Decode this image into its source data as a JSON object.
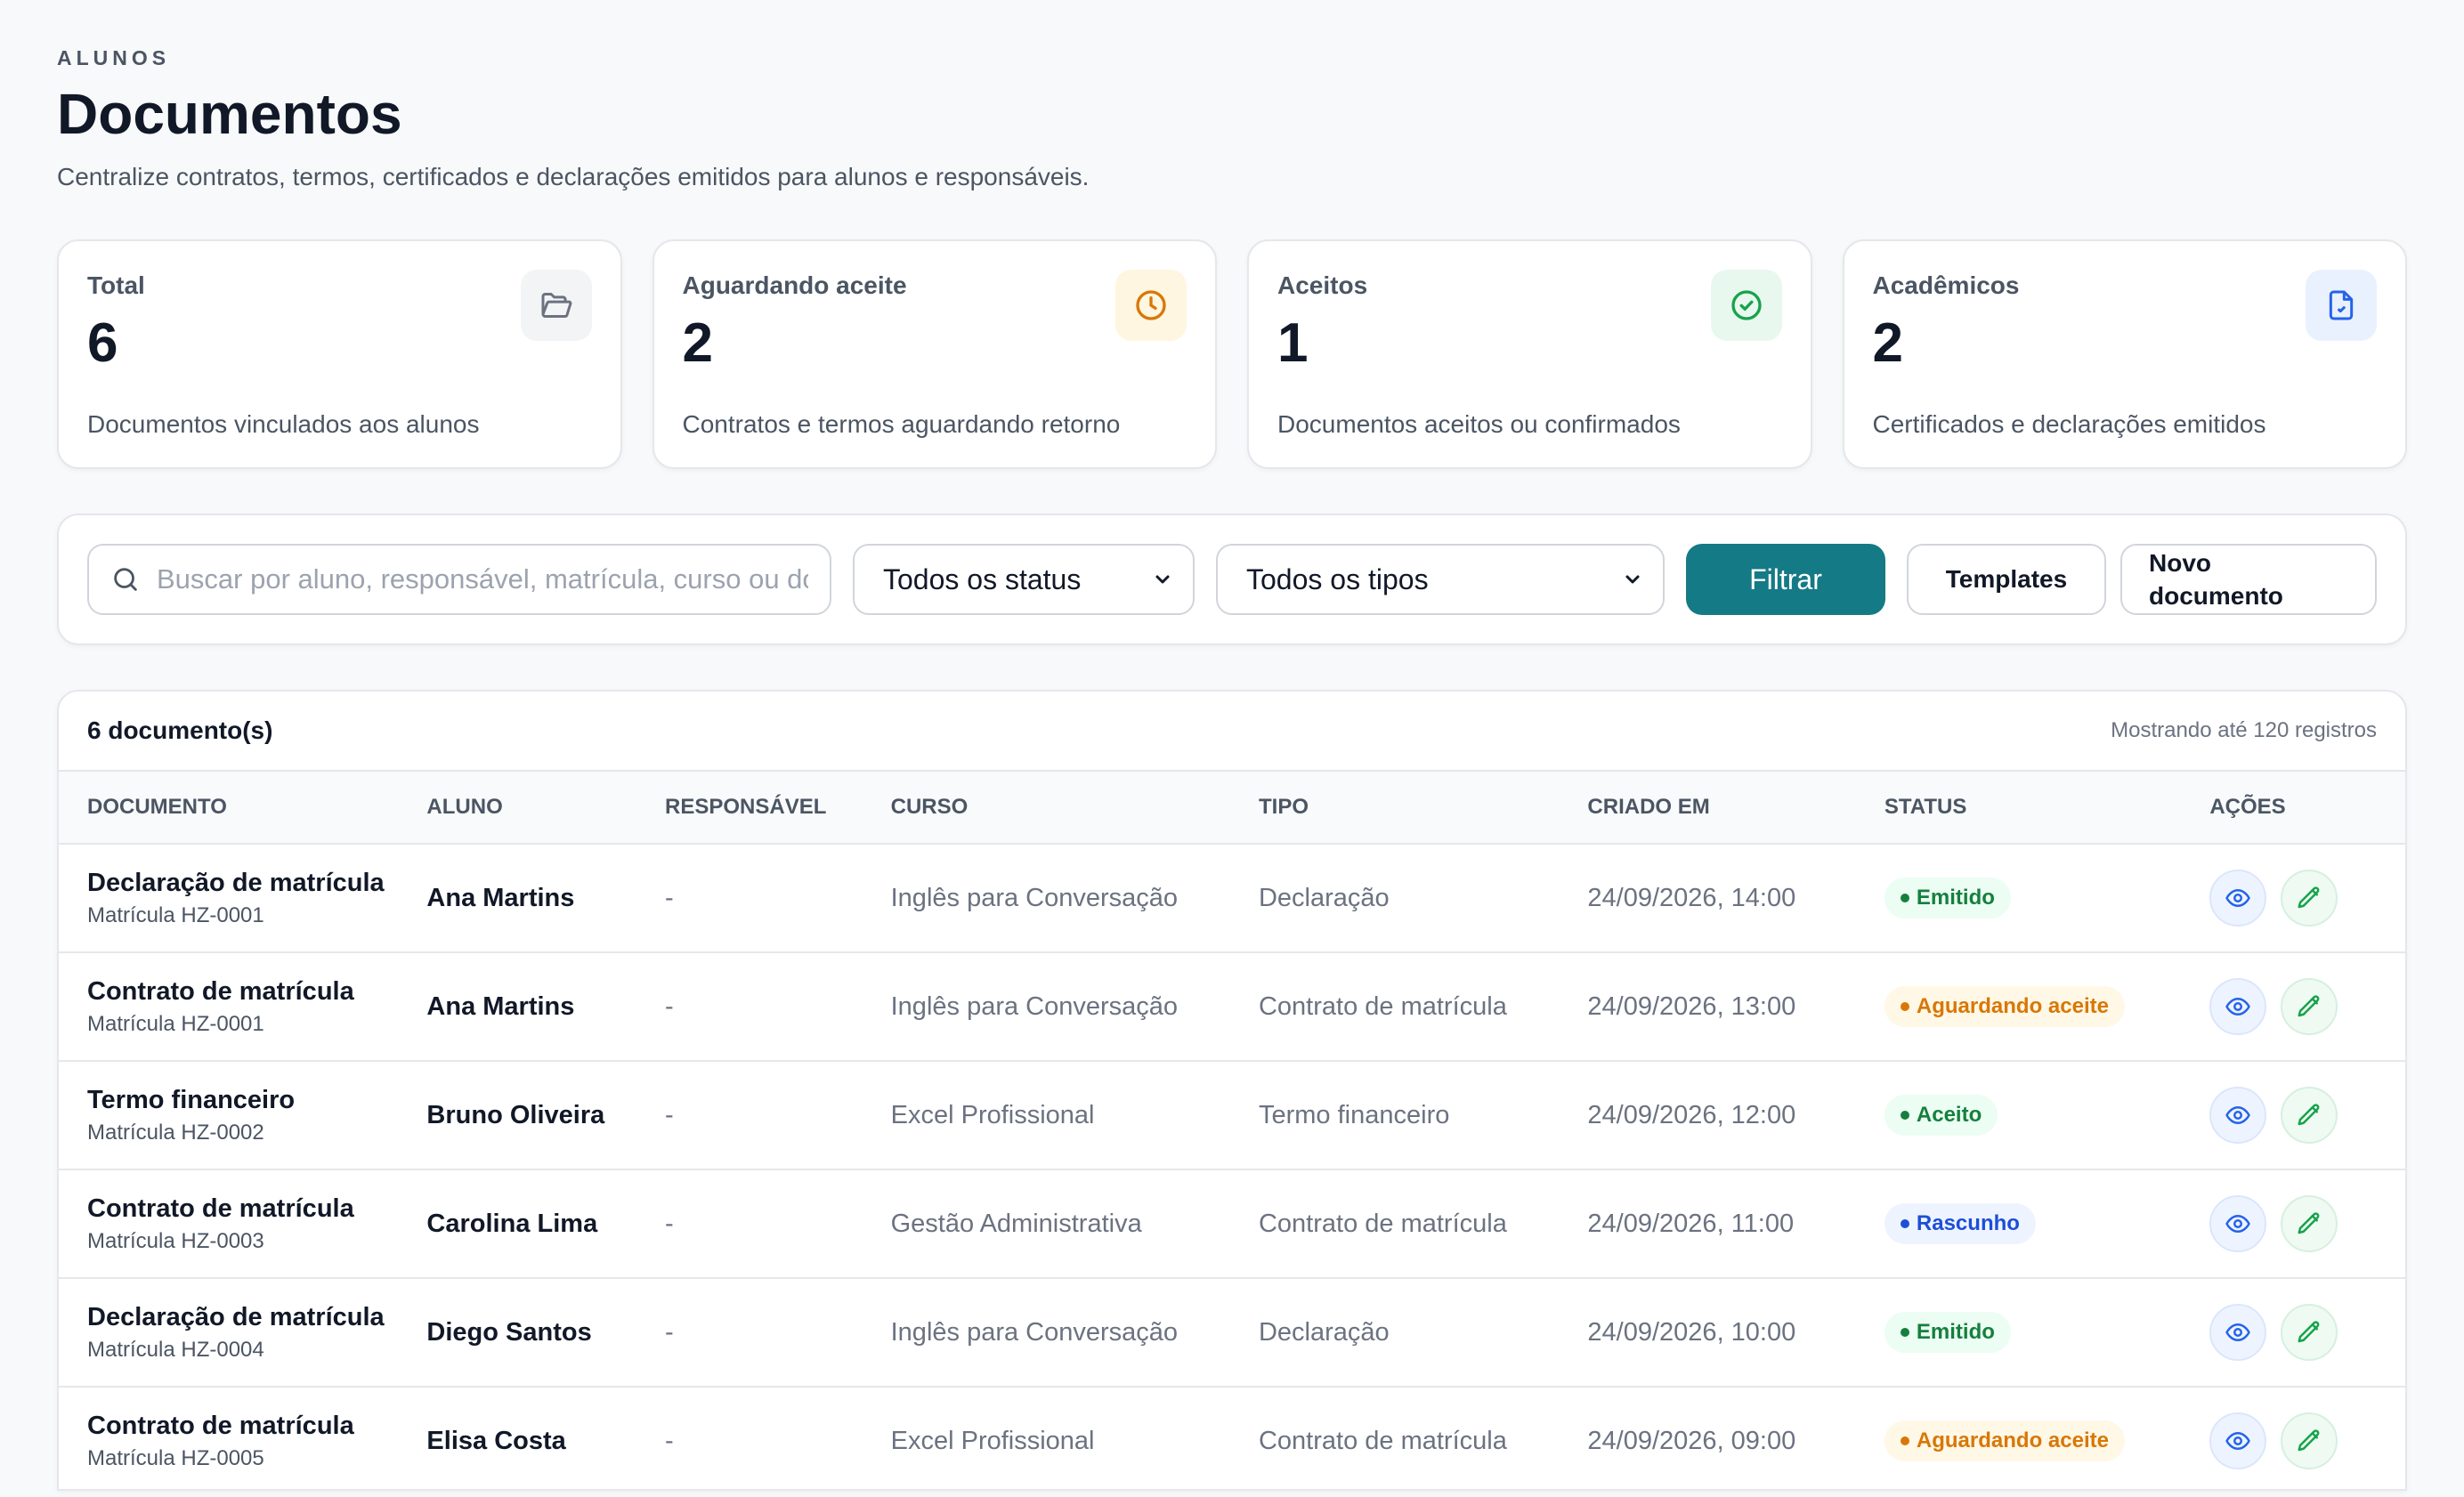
{
  "header": {
    "eyebrow": "ALUNOS",
    "title": "Documentos",
    "subtitle": "Centralize contratos, termos, certificados e declarações emitidos para alunos e responsáveis."
  },
  "stats": [
    {
      "label": "Total",
      "value": "6",
      "desc": "Documentos vinculados aos alunos",
      "icon": "folder-icon",
      "color": "#6b7280"
    },
    {
      "label": "Aguardando aceite",
      "value": "2",
      "desc": "Contratos e termos aguardando retorno",
      "icon": "clock-icon",
      "color": "#d97706"
    },
    {
      "label": "Aceitos",
      "value": "1",
      "desc": "Documentos aceitos ou confirmados",
      "icon": "check-circle-icon",
      "color": "#16a34a"
    },
    {
      "label": "Acadêmicos",
      "value": "2",
      "desc": "Certificados e declarações emitidos",
      "icon": "file-icon",
      "color": "#2563eb"
    }
  ],
  "filters": {
    "search_placeholder": "Buscar por aluno, responsável, matrícula, curso ou documento",
    "status_select": "Todos os status",
    "type_select": "Todos os tipos",
    "filter_label": "Filtrar",
    "templates_label": "Templates",
    "new_label": "Novo documento"
  },
  "table": {
    "count": "6 documento(s)",
    "showing": "Mostrando até 120 registros",
    "columns": [
      "DOCUMENTO",
      "ALUNO",
      "RESPONSÁVEL",
      "CURSO",
      "TIPO",
      "CRIADO EM",
      "STATUS",
      "AÇÕES"
    ],
    "rows": [
      {
        "title": "Declaração de matrícula",
        "sub": "Matrícula HZ-0001",
        "student": "Ana Martins",
        "resp": "-",
        "course": "Inglês para Conversação",
        "type": "Declaração",
        "created": "24/09/2026, 14:00",
        "status": "Emitido"
      },
      {
        "title": "Contrato de matrícula",
        "sub": "Matrícula HZ-0001",
        "student": "Ana Martins",
        "resp": "-",
        "course": "Inglês para Conversação",
        "type": "Contrato de matrícula",
        "created": "24/09/2026, 13:00",
        "status": "Aguardando aceite"
      },
      {
        "title": "Termo financeiro",
        "sub": "Matrícula HZ-0002",
        "student": "Bruno Oliveira",
        "resp": "-",
        "course": "Excel Profissional",
        "type": "Termo financeiro",
        "created": "24/09/2026, 12:00",
        "status": "Aceito"
      },
      {
        "title": "Contrato de matrícula",
        "sub": "Matrícula HZ-0003",
        "student": "Carolina Lima",
        "resp": "-",
        "course": "Gestão Administrativa",
        "type": "Contrato de matrícula",
        "created": "24/09/2026, 11:00",
        "status": "Rascunho"
      },
      {
        "title": "Declaração de matrícula",
        "sub": "Matrícula HZ-0004",
        "student": "Diego Santos",
        "resp": "-",
        "course": "Inglês para Conversação",
        "type": "Declaração",
        "created": "24/09/2026, 10:00",
        "status": "Emitido"
      },
      {
        "title": "Contrato de matrícula",
        "sub": "Matrícula HZ-0005",
        "student": "Elisa Costa",
        "resp": "-",
        "course": "Excel Profissional",
        "type": "Contrato de matrícula",
        "created": "24/09/2026, 09:00",
        "status": "Aguardando aceite"
      }
    ]
  },
  "status_colors": {
    "Emitido": {
      "bg": "#ecfdf3",
      "fg": "#15803d"
    },
    "Aguardando aceite": {
      "bg": "#fff8e6",
      "fg": "#d97706"
    },
    "Aceito": {
      "bg": "#ecfdf3",
      "fg": "#15803d"
    },
    "Rascunho": {
      "bg": "#eef4ff",
      "fg": "#1d4ed8"
    }
  },
  "accent": "#147a86"
}
